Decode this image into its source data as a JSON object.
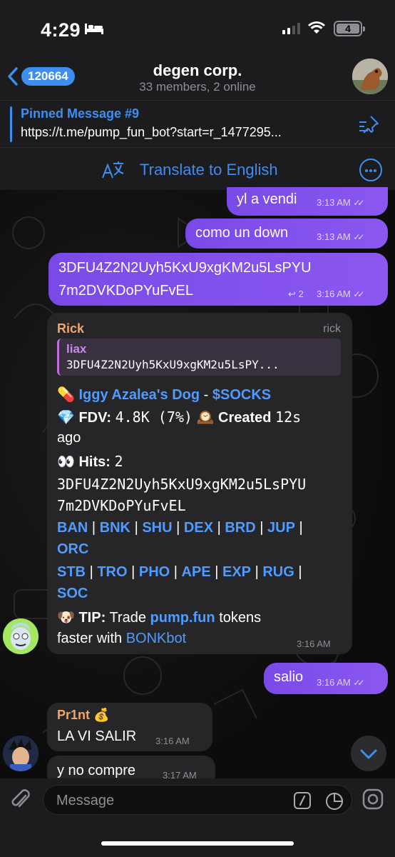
{
  "status": {
    "time": "4:29",
    "battery": "4"
  },
  "header": {
    "back_count": "120664",
    "title": "degen corp.",
    "subtitle": "33 members, 2 online"
  },
  "pinned": {
    "title": "Pinned Message #9",
    "text": "https://t.me/pump_fun_bot?start=r_1477295..."
  },
  "translate": {
    "label": "Translate to English"
  },
  "messages": [
    {
      "text": "yl a vendi",
      "time": "3:13 AM"
    },
    {
      "text": "como un down",
      "time": "3:13 AM"
    },
    {
      "line1": "3DFU4Z2N2Uyh5KxU9xgKM2u5LsPYU",
      "line2": "7m2DVKDoPYuFvEL",
      "replies": "2",
      "time": "3:16 AM"
    }
  ],
  "rick": {
    "sender": "Rick",
    "handle": "rick",
    "reply_name": "liax",
    "reply_text": "3DFU4Z2N2Uyh5KxU9xgKM2u5LsPY...",
    "pill": "💊",
    "token_name": "Iggy Azalea's Dog",
    "dash": " - ",
    "ticker": "$SOCKS",
    "gem": "💎",
    "fdv_label": "FDV:",
    "fdv_value": "4.8K (7%)",
    "clock": "🕰️",
    "created": "Created",
    "created_value": "12s",
    "ago": "ago",
    "eyes": "👀",
    "hits_label": "Hits:",
    "hits_value": "2",
    "addr1": "3DFU4Z2N2Uyh5KxU9xgKM2u5LsPYU",
    "addr2": "7m2DVKDoPYuFvEL",
    "links_row1": [
      "BAN",
      "BNK",
      "SHU",
      "DEX",
      "BRD",
      "JUP"
    ],
    "links_row2": [
      "ORC"
    ],
    "links_row3": [
      "STB",
      "TRO",
      "PHO",
      "APE",
      "EXP",
      "RUG"
    ],
    "links_row4": [
      "SOC"
    ],
    "sep": "|",
    "dog": "🐶",
    "tip_label": "TIP:",
    "tip_text1": "Trade",
    "tip_link1": "pump.fun",
    "tip_text2": "tokens",
    "tip_text3": "faster with",
    "tip_link2": "BONKbot",
    "time": "3:16 AM"
  },
  "salio": {
    "text": "salio",
    "time": "3:16 AM"
  },
  "print": {
    "sender": "Pr1nt",
    "emoji": "💰",
    "msg1": "LA VI SALIR",
    "time1": "3:16 AM",
    "msg2": "y no compre",
    "time2": "3:17 AM"
  },
  "input": {
    "placeholder": "Message"
  },
  "colors": {
    "accent": "#3d8ef0",
    "outgoing": "#8153ed",
    "incoming": "#262628",
    "sender_orange": "#f3a567"
  }
}
